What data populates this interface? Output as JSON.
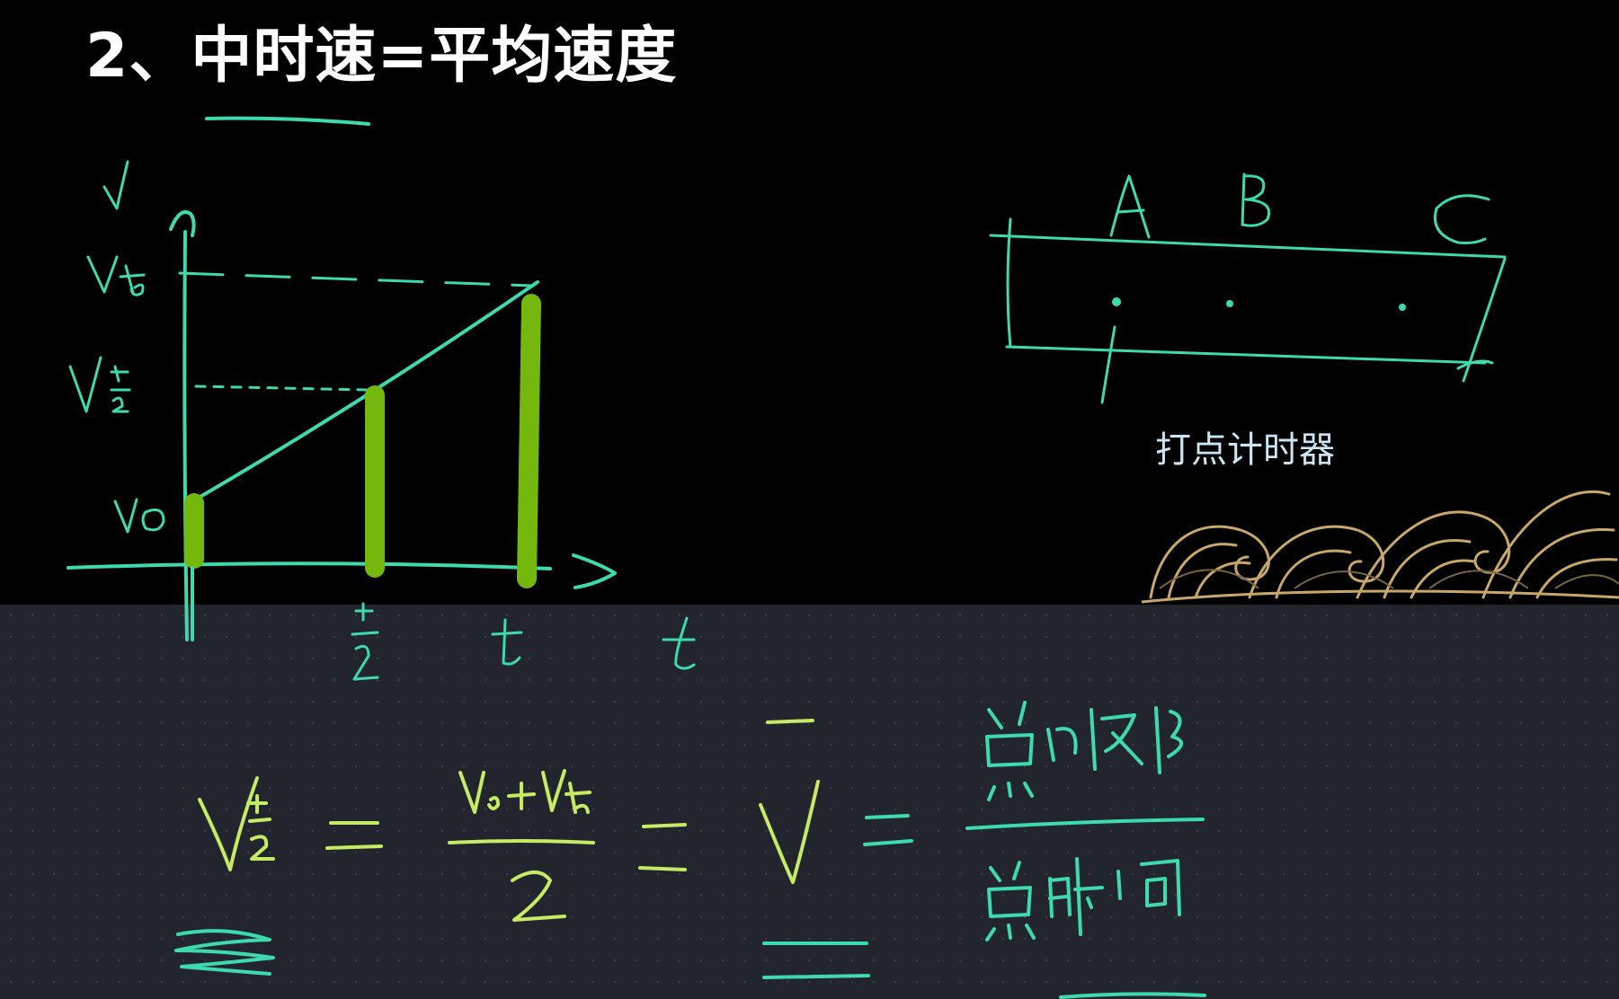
{
  "slide": {
    "title": "2、中时速=平均速度",
    "colors": {
      "background": "#000000",
      "title": "#ffffff",
      "caption": "#c9e6f2"
    }
  },
  "timer_diagram": {
    "caption": "打点计时器",
    "points": [
      "A",
      "B",
      "C"
    ]
  },
  "graph": {
    "axis_labels": {
      "y": "v",
      "x": "t"
    },
    "value_labels": [
      "Vt",
      "Vt/2",
      "V0"
    ],
    "tick_labels": [
      "t/2",
      "t"
    ]
  },
  "handwriting": {
    "ink_colors": {
      "teal": "#3fd9ae",
      "lime": "#c5ea63",
      "bar": "#75b80d"
    },
    "equation_parts": [
      "Vt/2",
      "V0+Vt",
      "2",
      "v̄",
      "总位移",
      "总时间"
    ]
  },
  "board": {
    "background": "#22252e",
    "dot_pattern": "dotted-grid"
  }
}
